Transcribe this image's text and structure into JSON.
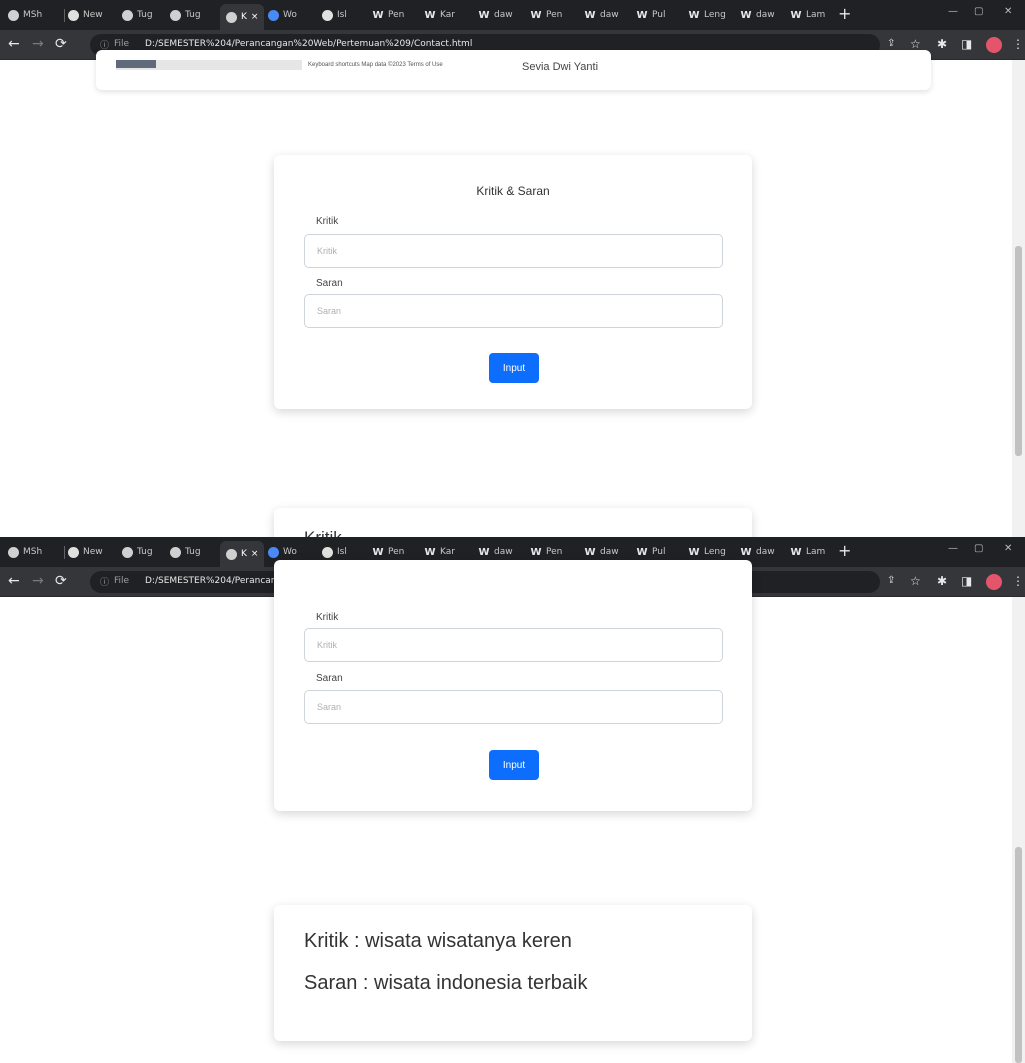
{
  "browser": {
    "tabs": [
      {
        "label": "MSh"
      },
      {
        "label": "New"
      },
      {
        "label": "Tug"
      },
      {
        "label": "Tug"
      },
      {
        "label": "K"
      },
      {
        "label": "Wo"
      },
      {
        "label": "Isl"
      },
      {
        "label": "Pen"
      },
      {
        "label": "Kar"
      },
      {
        "label": "daw"
      },
      {
        "label": "Pen"
      },
      {
        "label": "daw"
      },
      {
        "label": "Pul"
      },
      {
        "label": "Leng"
      },
      {
        "label": "daw"
      },
      {
        "label": "Lam"
      }
    ],
    "new_tab": "+",
    "file_label": "File",
    "url": "D:/SEMESTER%204/Perancangan%20Web/Pertemuan%209/Contact.html",
    "colors": {
      "tabbar": "#202124",
      "toolbar": "#35363a",
      "profile": "#e4556c"
    }
  },
  "top_card": {
    "map_attribution": "Keyboard shortcuts   Map data ©2023   Terms of Use",
    "author": "Sevia Dwi Yanti"
  },
  "form": {
    "title": "Kritik & Saran",
    "kritik_label": "Kritik",
    "kritik_placeholder": "Kritik",
    "saran_label": "Saran",
    "saran_placeholder": "Saran",
    "submit_label": "Input",
    "button_color": "#0d6efd"
  },
  "peek_title": "Kritik",
  "result": {
    "kritik_line": "Kritik : wisata wisatanya keren",
    "saran_line": "Saran : wisata indonesia terbaik"
  }
}
